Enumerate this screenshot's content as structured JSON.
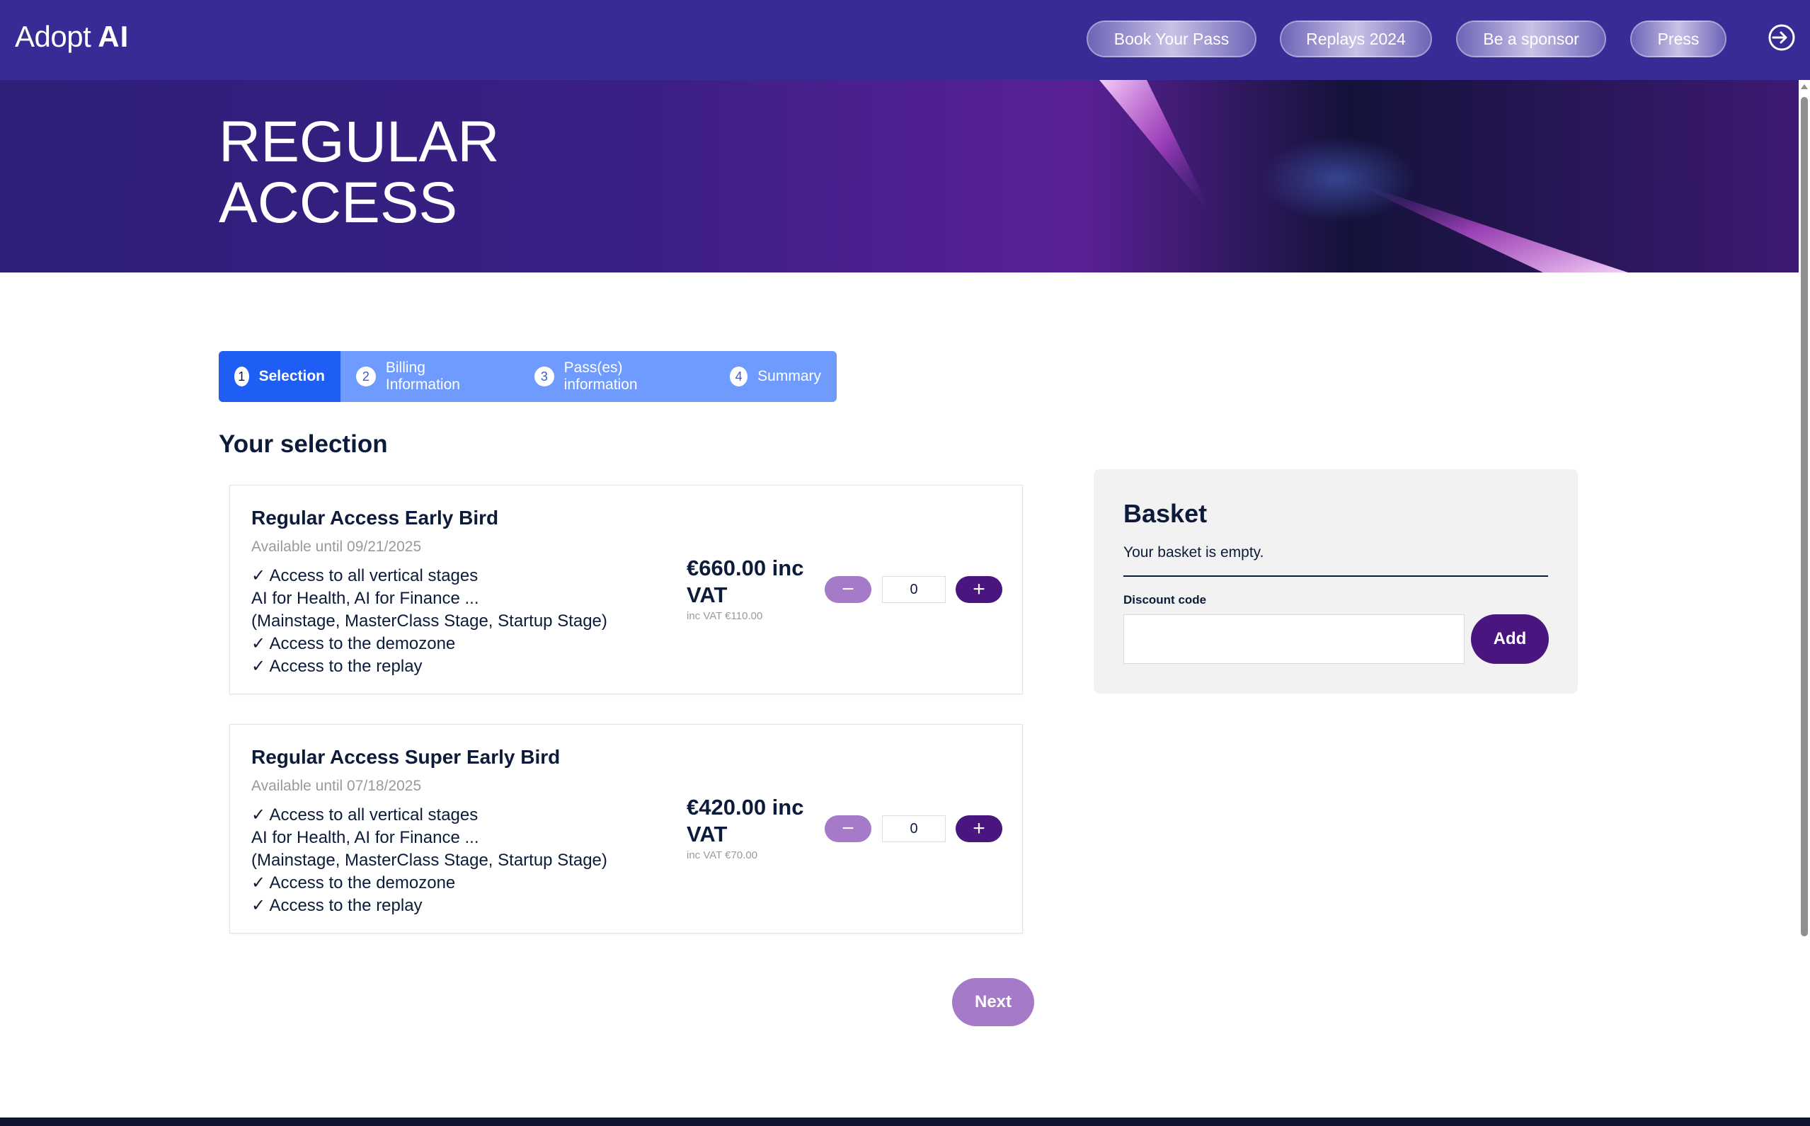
{
  "header": {
    "logo_text": "Adopt",
    "logo_mark": "AI",
    "nav": [
      "Book Your Pass",
      "Replays 2024",
      "Be a sponsor",
      "Press"
    ],
    "login_icon": "login-icon"
  },
  "hero": {
    "title_line1": "REGULAR",
    "title_line2": "ACCESS"
  },
  "stepper": {
    "steps": [
      {
        "num": "1",
        "label": "Selection",
        "active": true
      },
      {
        "num": "2",
        "label": "Billing Information",
        "active": false
      },
      {
        "num": "3",
        "label": "Pass(es) information",
        "active": false
      },
      {
        "num": "4",
        "label": "Summary",
        "active": false
      }
    ]
  },
  "selection": {
    "title": "Your selection",
    "products": [
      {
        "name": "Regular Access Early Bird",
        "availability": "Available until 09/21/2025",
        "features": [
          "✓ Access to all vertical stages",
          "AI for Health, AI for Finance ...",
          "(Mainstage, MasterClass Stage, Startup Stage)",
          "✓ Access to the demozone",
          "✓ Access to the replay"
        ],
        "price": "€660.00 inc VAT",
        "vat": "inc VAT €110.00",
        "quantity": "0",
        "minus": "−",
        "plus": "+"
      },
      {
        "name": "Regular Access Super Early Bird",
        "availability": "Available until 07/18/2025",
        "features": [
          "✓ Access to all vertical stages",
          "AI for Health, AI for Finance ...",
          "(Mainstage, MasterClass Stage, Startup Stage)",
          "✓ Access to the demozone",
          "✓ Access to the replay"
        ],
        "price": "€420.00 inc VAT",
        "vat": "inc VAT €70.00",
        "quantity": "0",
        "minus": "−",
        "plus": "+"
      }
    ],
    "next_label": "Next"
  },
  "basket": {
    "title": "Basket",
    "empty_text": "Your basket is empty.",
    "discount_label": "Discount code",
    "discount_value": "",
    "add_label": "Add"
  },
  "colors": {
    "nav_bg": "#382b96",
    "accent_purple": "#4b1580",
    "muted_purple": "#a57bc9",
    "step_active": "#1e5ef5",
    "step_bg": "#6f9bff"
  }
}
